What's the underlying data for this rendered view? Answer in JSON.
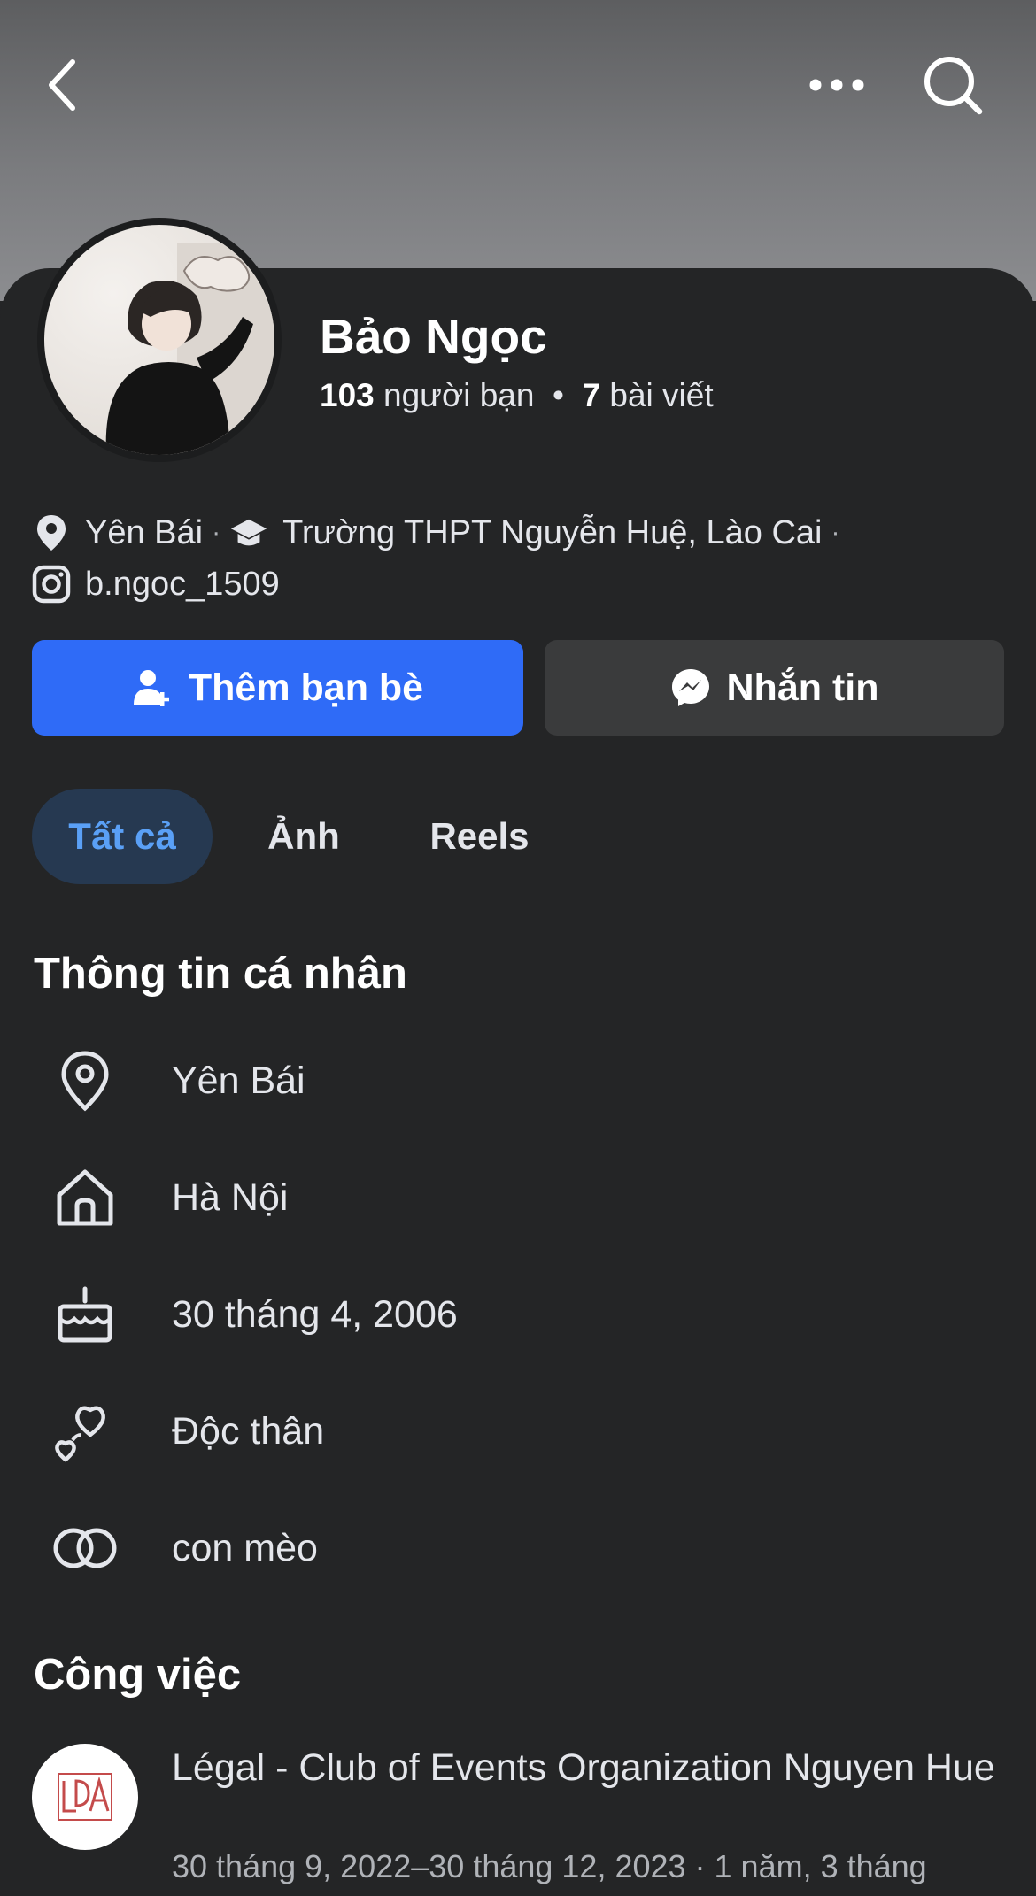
{
  "profile": {
    "name": "Bảo Ngọc",
    "friends_count": "103",
    "friends_label": "người bạn",
    "posts_count": "7",
    "posts_label": "bài viết"
  },
  "meta": {
    "location": "Yên Bái",
    "school": "Trường THPT Nguyễn Huệ, Lào Cai",
    "instagram": "b.ngoc_1509"
  },
  "actions": {
    "add_friend": "Thêm bạn bè",
    "message": "Nhắn tin"
  },
  "tabs": [
    {
      "label": "Tất cả",
      "active": true
    },
    {
      "label": "Ảnh",
      "active": false
    },
    {
      "label": "Reels",
      "active": false
    }
  ],
  "personal_info": {
    "title": "Thông tin cá nhân",
    "items": [
      {
        "icon": "location-pin-icon",
        "text": "Yên Bái"
      },
      {
        "icon": "home-icon",
        "text": "Hà Nội"
      },
      {
        "icon": "birthday-cake-icon",
        "text": "30 tháng 4, 2006"
      },
      {
        "icon": "hearts-icon",
        "text": "Độc thân"
      },
      {
        "icon": "rings-icon",
        "text": "con mèo"
      }
    ]
  },
  "work": {
    "title": "Công việc",
    "org": "Légal - Club of Events Organization Nguyen Hue",
    "dates": "30 tháng 9, 2022–30 tháng 12, 2023 · 1 năm, 3 tháng"
  },
  "colors": {
    "accent": "#2f6bf7",
    "background": "#242526",
    "tab_active_bg": "#263951",
    "tab_active_text": "#5aa0f6"
  }
}
